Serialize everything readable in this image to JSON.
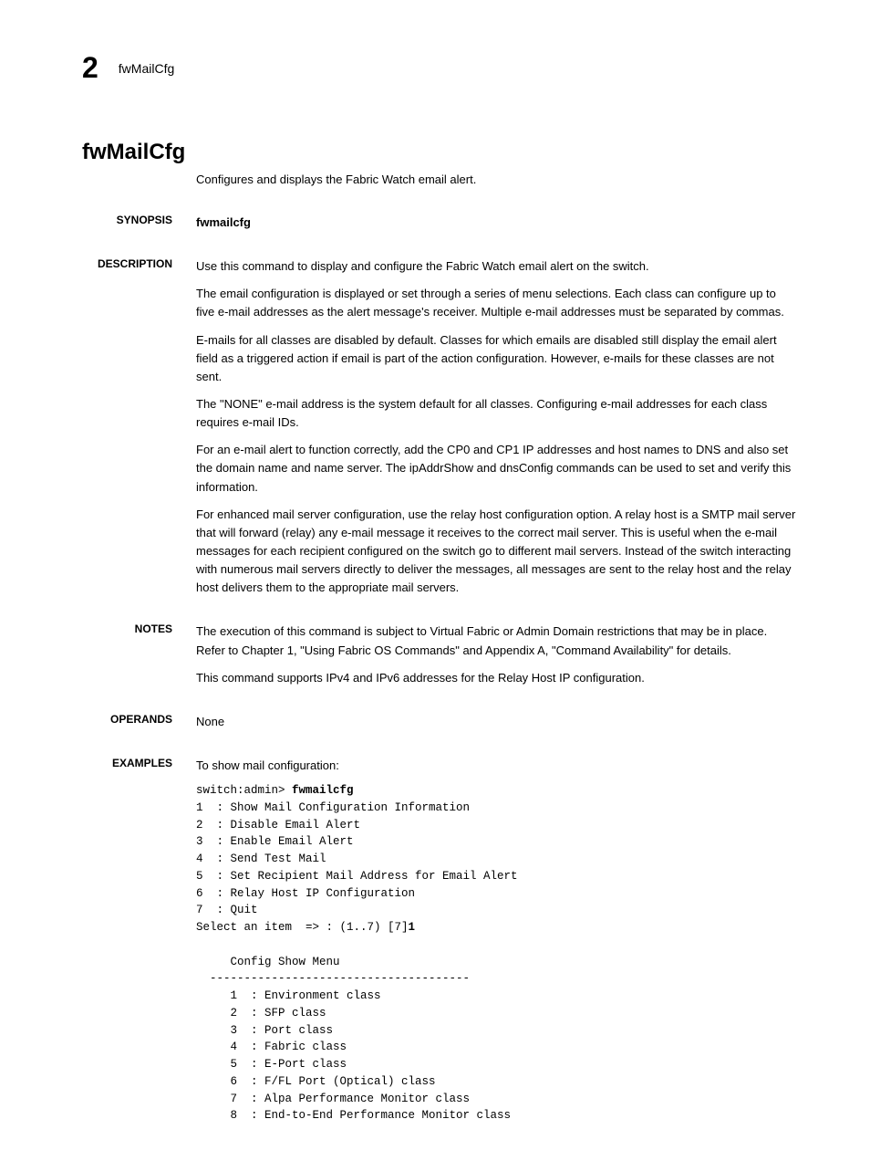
{
  "runningHeader": {
    "chapterNumber": "2",
    "title": "fwMailCfg"
  },
  "title": "fwMailCfg",
  "subtitle": "Configures and displays the Fabric Watch email alert.",
  "sections": {
    "synopsis": {
      "label": "SYNOPSIS",
      "body": "fwmailcfg"
    },
    "description": {
      "label": "DESCRIPTION",
      "paragraphs": [
        "Use this command to display and configure the Fabric Watch email alert on the switch.",
        "The email configuration is displayed or set through a series of menu selections. Each class can configure up to five e-mail addresses as the alert message's receiver. Multiple e-mail addresses must be separated by commas.",
        "E-mails for all classes are disabled by default. Classes for which emails are disabled still display the email alert field as a triggered action if email is part of the action configuration. However, e-mails for these classes are not sent.",
        "The \"NONE\" e-mail address is the system default for all classes. Configuring e-mail addresses for each class requires e-mail IDs.",
        "For an e-mail alert to function correctly, add the CP0 and CP1 IP addresses and host names to DNS and also set the domain name and name server. The ipAddrShow and dnsConfig commands can be used to set and verify this information.",
        "For enhanced mail server configuration, use the relay host configuration option. A relay host is a SMTP mail server that will forward (relay) any e-mail message it receives to the correct mail server. This is useful when the e-mail messages for each recipient configured on the switch go to different mail servers. Instead of the switch interacting with numerous mail servers directly to deliver the messages, all messages are sent to the relay host and the relay host delivers them to the appropriate mail servers."
      ]
    },
    "notes": {
      "label": "NOTES",
      "paragraphs": [
        "The execution of this command is subject to Virtual Fabric or Admin Domain restrictions that may be in place. Refer to Chapter 1, \"Using Fabric OS Commands\" and Appendix A, \"Command Availability\" for details.",
        "This command supports IPv4 and IPv6 addresses for the Relay Host IP configuration."
      ]
    },
    "operands": {
      "label": "OPERANDS",
      "body": "None"
    },
    "examples": {
      "label": "EXAMPLES",
      "body": "To show mail configuration:"
    }
  },
  "code": {
    "prompt": "switch:admin> ",
    "command": "fwmailcfg",
    "menu1": "1  : Show Mail Configuration Information\n2  : Disable Email Alert\n3  : Enable Email Alert\n4  : Send Test Mail\n5  : Set Recipient Mail Address for Email Alert\n6  : Relay Host IP Configuration\n7  : Quit\nSelect an item  => : (1..7) [7]",
    "selection1": "1",
    "submenuTitle": "     Config Show Menu",
    "divider": "  --------------------------------------",
    "submenu": "     1  : Environment class\n     2  : SFP class\n     3  : Port class\n     4  : Fabric class\n     5  : E-Port class\n     6  : F/FL Port (Optical) class\n     7  : Alpa Performance Monitor class\n     8  : End-to-End Performance Monitor class"
  }
}
